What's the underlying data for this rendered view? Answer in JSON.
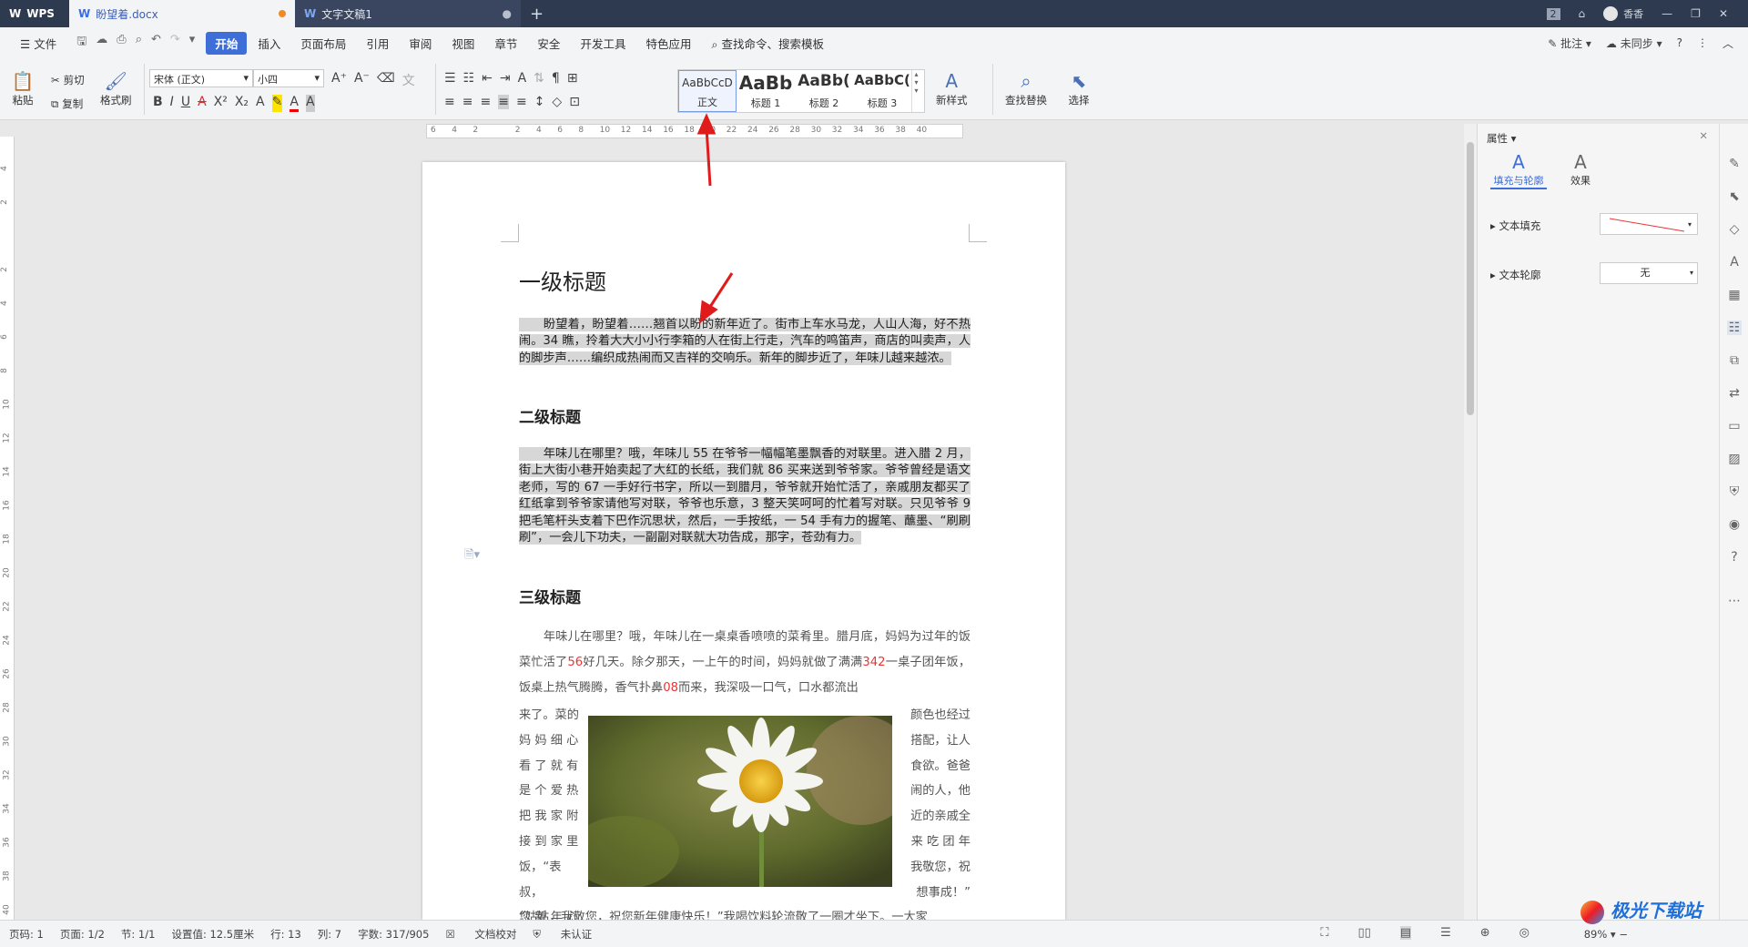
{
  "titlebar": {
    "app_tab": "WPS",
    "doc_tab": "盼望着.docx",
    "doc2_tab": "文字文稿1",
    "new_tab": "+",
    "badge": "2",
    "user": "香香"
  },
  "menubar": {
    "file": "文件",
    "items": [
      "开始",
      "插入",
      "页面布局",
      "引用",
      "审阅",
      "视图",
      "章节",
      "安全",
      "开发工具",
      "特色应用"
    ],
    "search": "查找命令、搜索模板",
    "comment": "批注",
    "sync": "未同步"
  },
  "ribbon": {
    "paste": "粘贴",
    "cut": "剪切",
    "copy": "复制",
    "format_painter": "格式刷",
    "font_name": "宋体 (正文)",
    "font_size": "小四",
    "styles": [
      {
        "preview": "AaBbCcD",
        "name": "正文"
      },
      {
        "preview": "AaBb",
        "name": "标题 1"
      },
      {
        "preview": "AaBb(",
        "name": "标题 2"
      },
      {
        "preview": "AaBbC(",
        "name": "标题 3"
      }
    ],
    "new_style": "新样式",
    "find_replace": "查找替换",
    "select": "选择"
  },
  "ruler": {
    "ticks": [
      "6",
      "4",
      "2",
      "",
      "2",
      "4",
      "6",
      "8",
      "10",
      "12",
      "14",
      "16",
      "18",
      "20",
      "22",
      "24",
      "26",
      "28",
      "30",
      "32",
      "34",
      "36",
      "38",
      "40"
    ],
    "vticks": [
      "4",
      "2",
      "",
      "2",
      "4",
      "6",
      "8",
      "10",
      "12",
      "14",
      "16",
      "18",
      "20",
      "22",
      "24",
      "26",
      "28",
      "30",
      "32",
      "34",
      "36",
      "38",
      "40"
    ]
  },
  "document": {
    "h1": "一级标题",
    "p1": "盼望着，盼望着……翘首以盼的新年近了。街市上车水马龙，人山人海，好不热闹。34 瞧，拎着大大小小行李箱的人在街上行走，汽车的鸣笛声，商店的叫卖声，人的脚步声……编织成热闹而又吉祥的交响乐。新年的脚步近了，年味儿越来越浓。",
    "h2": "二级标题",
    "p2": "年味儿在哪里？哦，年味儿 55 在爷爷一幅幅笔墨飘香的对联里。进入腊 2 月，街上大街小巷开始卖起了大红的长纸，我们就 86 买来送到爷爷家。爷爷曾经是语文老师，写的 67 一手好行书字，所以一到腊月，爷爷就开始忙活了，亲戚朋友都买了红纸拿到爷爷家请他写对联，爷爷也乐意，3 整天笑呵呵的忙着写对联。只见爷爷 9 把毛笔杆头支着下巴作沉思状，然后，一手按纸，一 54 手有力的握笔、蘸墨、“刷刷刷”，一会儿下功夫，一副副对联就大功告成，那字，苍劲有力。",
    "h3": "三级标题",
    "p3a": "年味儿在哪里？哦，年味儿在一桌桌香喷喷的菜肴里。腊月底，妈妈为过年的饭菜忙活了",
    "p3_red1": "56",
    "p3b": "好几天。除夕那天，一上午的时间，妈妈就做了满满",
    "p3_red2": "342",
    "p3c": "一桌子团年饭，饭桌上热气腾腾，香气扑鼻",
    "p3_red3": "08",
    "p3d": "而来，我深吸一口气，口水都流出",
    "left_col": [
      "来了。菜的",
      "妈 妈 细 心",
      "看 了 就 有",
      "是 个 爱 热",
      "把 我 家 附",
      "接 到 家 里",
      "饭，“表叔，",
      "您 新 年 心"
    ],
    "right_col": [
      "颜色也经过",
      "搭配，让人",
      "食欲。爸爸",
      "闹的人，他",
      "近的亲戚全",
      "来 吃 团 年",
      "我敬您，祝",
      "想事成！”"
    ],
    "last_line": "“姑姑，我敬您，祝您新年健康快乐！”我喝饮料轮流敬了一圈才坐下。一大家"
  },
  "props": {
    "title": "属性",
    "tab_fill": "填充与轮廓",
    "tab_effect": "效果",
    "text_fill": "文本填充",
    "text_outline": "文本轮廓",
    "outline_value": "无"
  },
  "status": {
    "page": "页码: 1",
    "pages": "页面: 1/2",
    "section": "节: 1/1",
    "setting": "设置值: 12.5厘米",
    "row": "行: 13",
    "col": "列: 7",
    "words": "字数: 317/905",
    "proof": "文档校对",
    "auth": "未认证",
    "zoom": "89%"
  },
  "watermark": "极光下载站",
  "colors": {
    "accent": "#3e6fd8",
    "highlight": "#d7d7d7",
    "arrow": "#e01b1b",
    "red_num": "#e33333"
  }
}
